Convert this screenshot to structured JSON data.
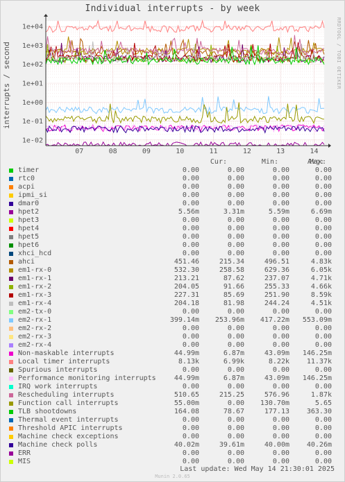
{
  "header": {
    "title": "Individual interrupts - by week"
  },
  "side_text": "RRDTOOL / TOBI OETIKER",
  "footer": {
    "last_update": "Last update: Wed May 14 21:30:01 2025",
    "munin": "Munin 2.0.65"
  },
  "legend_headers": {
    "cur": "Cur:",
    "min": "Min:",
    "avg": "Avg:",
    "max": "Max:"
  },
  "chart_data": {
    "type": "line",
    "title": "Individual interrupts - by week",
    "ylabel": "interrupts / second",
    "xlabel": "",
    "yscale": "log",
    "ylim": [
      0.005,
      20000
    ],
    "x_ticks": [
      "07",
      "08",
      "09",
      "10",
      "11",
      "12",
      "13",
      "14"
    ],
    "y_ticks": [
      "1e-02",
      "1e-01",
      "1e+00",
      "1e+01",
      "1e+02",
      "1e+03",
      "1e+04"
    ],
    "grid": true,
    "series": [
      {
        "name": "timer",
        "color": "#00cc00",
        "cur": "0.00",
        "min": "0.00",
        "avg": "0.00",
        "max": "0.00"
      },
      {
        "name": "rtc0",
        "color": "#0066b3",
        "cur": "0.00",
        "min": "0.00",
        "avg": "0.00",
        "max": "0.00"
      },
      {
        "name": "acpi",
        "color": "#ff8000",
        "cur": "0.00",
        "min": "0.00",
        "avg": "0.00",
        "max": "0.00"
      },
      {
        "name": "ipmi_si",
        "color": "#ffcc00",
        "cur": "0.00",
        "min": "0.00",
        "avg": "0.00",
        "max": "0.00"
      },
      {
        "name": "dmar0",
        "color": "#330099",
        "cur": "0.00",
        "min": "0.00",
        "avg": "0.00",
        "max": "0.00"
      },
      {
        "name": "hpet2",
        "color": "#990099",
        "cur": "5.56m",
        "min": "3.31m",
        "avg": "5.59m",
        "max": "6.69m",
        "level": 0.0056
      },
      {
        "name": "hpet3",
        "color": "#ccff00",
        "cur": "0.00",
        "min": "0.00",
        "avg": "0.00",
        "max": "0.00"
      },
      {
        "name": "hpet4",
        "color": "#ff0000",
        "cur": "0.00",
        "min": "0.00",
        "avg": "0.00",
        "max": "0.00"
      },
      {
        "name": "hpet5",
        "color": "#808080",
        "cur": "0.00",
        "min": "0.00",
        "avg": "0.00",
        "max": "0.00"
      },
      {
        "name": "hpet6",
        "color": "#008f00",
        "cur": "0.00",
        "min": "0.00",
        "avg": "0.00",
        "max": "0.00"
      },
      {
        "name": "xhci_hcd",
        "color": "#00487d",
        "cur": "0.00",
        "min": "0.00",
        "avg": "0.00",
        "max": "0.00"
      },
      {
        "name": "ahci",
        "color": "#b35a00",
        "cur": "451.46",
        "min": "215.34",
        "avg": "496.51",
        "max": "4.83k",
        "level": 450
      },
      {
        "name": "em1-rx-0",
        "color": "#b38f00",
        "cur": "532.30",
        "min": "258.58",
        "avg": "629.36",
        "max": "6.05k",
        "level": 530
      },
      {
        "name": "em1-rx-1",
        "color": "#6b006b",
        "cur": "213.21",
        "min": "87.62",
        "avg": "237.07",
        "max": "4.71k",
        "level": 210
      },
      {
        "name": "em1-rx-2",
        "color": "#8fb300",
        "cur": "204.05",
        "min": "91.66",
        "avg": "255.33",
        "max": "4.66k",
        "level": 200
      },
      {
        "name": "em1-rx-3",
        "color": "#b30000",
        "cur": "227.31",
        "min": "85.69",
        "avg": "251.90",
        "max": "8.59k",
        "level": 225
      },
      {
        "name": "em1-rx-4",
        "color": "#bebebe",
        "cur": "204.18",
        "min": "81.98",
        "avg": "244.24",
        "max": "4.51k",
        "level": 200
      },
      {
        "name": "em2-tx-0",
        "color": "#80ff80",
        "cur": "0.00",
        "min": "0.00",
        "avg": "0.00",
        "max": "0.00"
      },
      {
        "name": "em2-rx-1",
        "color": "#80c9ff",
        "cur": "399.14m",
        "min": "253.96m",
        "avg": "417.22m",
        "max": "553.09m",
        "level": 0.4
      },
      {
        "name": "em2-rx-2",
        "color": "#ffc080",
        "cur": "0.00",
        "min": "0.00",
        "avg": "0.00",
        "max": "0.00"
      },
      {
        "name": "em2-rx-3",
        "color": "#ffe680",
        "cur": "0.00",
        "min": "0.00",
        "avg": "0.00",
        "max": "0.00"
      },
      {
        "name": "em2-rx-4",
        "color": "#aa80ff",
        "cur": "0.00",
        "min": "0.00",
        "avg": "0.00",
        "max": "0.00"
      },
      {
        "name": "Non-maskable interrupts",
        "color": "#ee00cc",
        "cur": "44.99m",
        "min": "6.87m",
        "avg": "43.09m",
        "max": "146.25m",
        "level": 0.045
      },
      {
        "name": "Local timer interrupts",
        "color": "#ff8080",
        "cur": "8.13k",
        "min": "6.99k",
        "avg": "8.22k",
        "max": "11.37k",
        "level": 8130
      },
      {
        "name": "Spurious interrupts",
        "color": "#666600",
        "cur": "0.00",
        "min": "0.00",
        "avg": "0.00",
        "max": "0.00"
      },
      {
        "name": "Performance monitoring interrupts",
        "color": "#ffbfff",
        "cur": "44.99m",
        "min": "6.87m",
        "avg": "43.09m",
        "max": "146.25m",
        "level": 0.045
      },
      {
        "name": "IRQ work interrupts",
        "color": "#00ffcc",
        "cur": "0.00",
        "min": "0.00",
        "avg": "0.00",
        "max": "0.00"
      },
      {
        "name": "Rescheduling interrupts",
        "color": "#cc6699",
        "cur": "510.65",
        "min": "215.25",
        "avg": "576.96",
        "max": "1.87k",
        "level": 510
      },
      {
        "name": "Function call interrupts",
        "color": "#999900",
        "cur": "55.00m",
        "min": "0.00",
        "avg": "130.70m",
        "max": "5.65",
        "level": 0.13
      },
      {
        "name": "TLB shootdowns",
        "color": "#00cc00",
        "cur": "164.08",
        "min": "78.67",
        "avg": "177.13",
        "max": "363.30",
        "level": 164
      },
      {
        "name": "Thermal event interrupts",
        "color": "#0066b3",
        "cur": "0.00",
        "min": "0.00",
        "avg": "0.00",
        "max": "0.00"
      },
      {
        "name": "Threshold APIC interrupts",
        "color": "#ff8000",
        "cur": "0.00",
        "min": "0.00",
        "avg": "0.00",
        "max": "0.00"
      },
      {
        "name": "Machine check exceptions",
        "color": "#ffcc00",
        "cur": "0.00",
        "min": "0.00",
        "avg": "0.00",
        "max": "0.00"
      },
      {
        "name": "Machine check polls",
        "color": "#330099",
        "cur": "40.02m",
        "min": "39.61m",
        "avg": "40.00m",
        "max": "40.26m",
        "level": 0.04
      },
      {
        "name": "ERR",
        "color": "#990099",
        "cur": "0.00",
        "min": "0.00",
        "avg": "0.00",
        "max": "0.00"
      },
      {
        "name": "MIS",
        "color": "#ccff00",
        "cur": "0.00",
        "min": "0.00",
        "avg": "0.00",
        "max": "0.00"
      }
    ]
  }
}
